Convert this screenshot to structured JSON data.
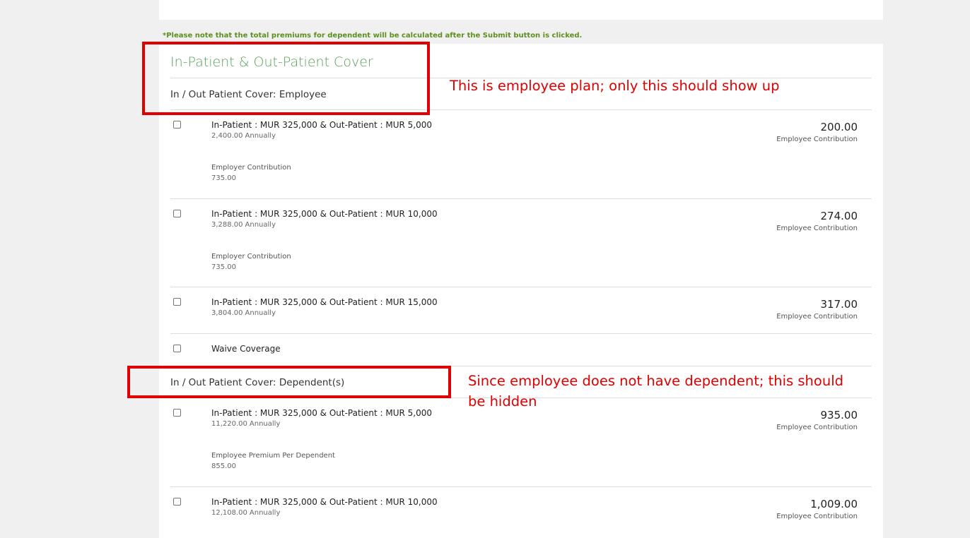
{
  "note": "*Please note that the total premiums for dependent will be calculated after the Submit button is clicked.",
  "section": {
    "title": "In-Patient & Out-Patient Cover"
  },
  "employee_group": {
    "heading": "In / Out Patient Cover: Employee",
    "options": [
      {
        "name": "In-Patient : MUR 325,000 & Out-Patient : MUR 5,000",
        "annual": "2,400.00",
        "annual_unit": "Annually",
        "amount": "200.00",
        "amount_label": "Employee Contribution",
        "extra_label": "Employer Contribution",
        "extra_value": "735.00"
      },
      {
        "name": "In-Patient : MUR 325,000 & Out-Patient : MUR 10,000",
        "annual": "3,288.00",
        "annual_unit": "Annually",
        "amount": "274.00",
        "amount_label": "Employee Contribution",
        "extra_label": "Employer Contribution",
        "extra_value": "735.00"
      },
      {
        "name": "In-Patient : MUR 325,000 & Out-Patient : MUR 15,000",
        "annual": "3,804.00",
        "annual_unit": "Annually",
        "amount": "317.00",
        "amount_label": "Employee Contribution"
      }
    ],
    "waive_label": "Waive Coverage"
  },
  "dependent_group": {
    "heading": "In / Out Patient Cover: Dependent(s)",
    "options": [
      {
        "name": "In-Patient : MUR 325,000 & Out-Patient : MUR 5,000",
        "annual": "11,220.00",
        "annual_unit": "Annually",
        "amount": "935.00",
        "amount_label": "Employee Contribution",
        "extra_label": "Employee Premium Per Dependent",
        "extra_value": "855.00"
      },
      {
        "name": "In-Patient : MUR 325,000 & Out-Patient : MUR 10,000",
        "annual": "12,108.00",
        "annual_unit": "Annually",
        "amount": "1,009.00",
        "amount_label": "Employee Contribution"
      }
    ]
  },
  "annotations": {
    "employee_note": "This is employee plan; only this should show up",
    "dependent_note": "Since employee does not have dependent; this should be hidden",
    "color": "#e00000"
  }
}
